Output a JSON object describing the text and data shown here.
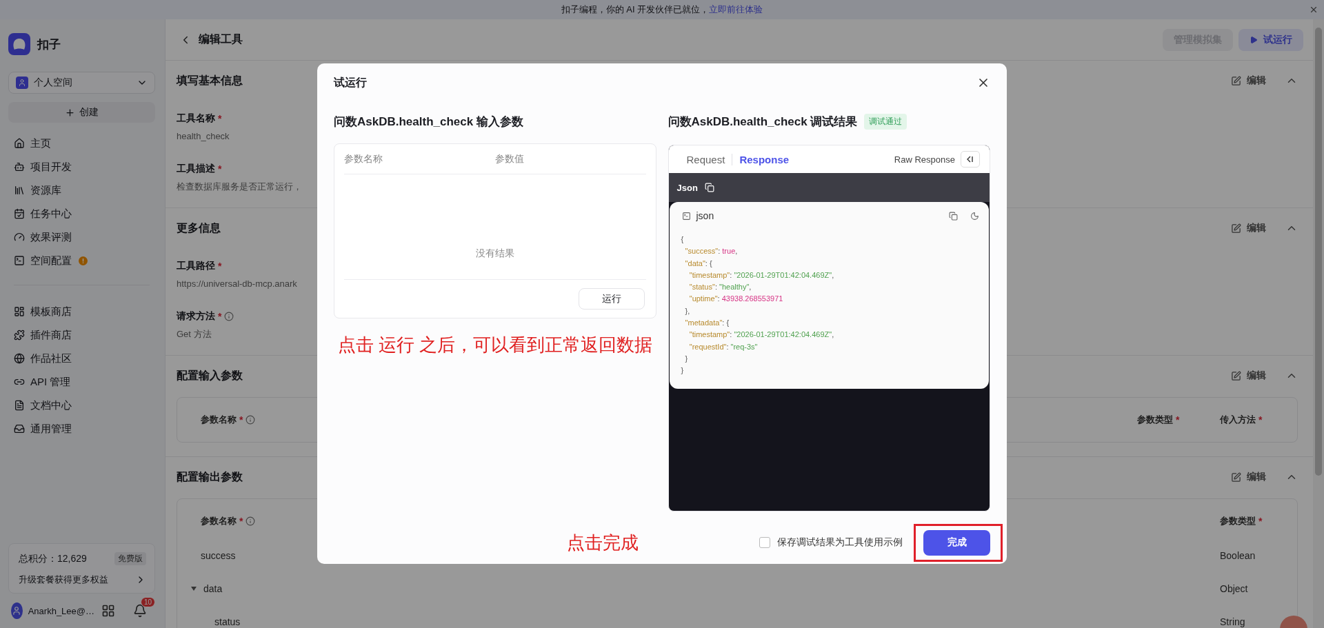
{
  "banner": {
    "text": "扣子编程，你的 AI 开发伙伴已就位，",
    "link": "立即前往体验"
  },
  "sidebar": {
    "brand": "扣子",
    "workspace": "个人空间",
    "create": "创建",
    "nav_groups": [
      [
        {
          "label": "主页",
          "alert": false
        },
        {
          "label": "项目开发",
          "alert": false
        },
        {
          "label": "资源库",
          "alert": false
        },
        {
          "label": "任务中心",
          "alert": false
        },
        {
          "label": "效果评测",
          "alert": false
        },
        {
          "label": "空间配置",
          "alert": true
        }
      ],
      [
        {
          "label": "模板商店",
          "alert": false
        },
        {
          "label": "插件商店",
          "alert": false
        },
        {
          "label": "作品社区",
          "alert": false
        },
        {
          "label": "API 管理",
          "alert": false
        },
        {
          "label": "文档中心",
          "alert": false
        },
        {
          "label": "通用管理",
          "alert": false
        }
      ]
    ],
    "points": {
      "total": "总积分：12,629",
      "plan": "免费版",
      "upgrade": "升级套餐获得更多权益"
    },
    "user": {
      "name": "Anarkh_Lee@…",
      "notifications": "10"
    }
  },
  "header": {
    "title": "编辑工具",
    "buttons": [
      {
        "label": "管理模拟集",
        "kind": "secondary",
        "disabled": true
      },
      {
        "label": "试运行",
        "kind": "primary",
        "disabled": false
      }
    ]
  },
  "sections": [
    {
      "title": "填写基本信息",
      "action": "编辑",
      "expanded": true,
      "fields": [
        {
          "label": "工具名称",
          "required_mark": "*",
          "info": false,
          "value": "health_check"
        },
        {
          "label": "工具描述",
          "required_mark": "*",
          "info": false,
          "value": "检查数据库服务是否正常运行，"
        }
      ]
    },
    {
      "title": "更多信息",
      "action": "编辑",
      "expanded": true,
      "fields": [
        {
          "label": "工具路径",
          "required_mark": "*",
          "info": false,
          "value": "https://universal-db-mcp.anark"
        },
        {
          "label": "请求方法",
          "required_mark": "*",
          "info": true,
          "value": "Get 方法"
        }
      ]
    },
    {
      "title": "配置输入参数",
      "action": "编辑",
      "expanded": true,
      "table": {
        "columns": [
          {
            "label": "参数名称",
            "required_mark": "*",
            "info": true
          },
          {
            "label": "参数类型",
            "required_mark": "*",
            "info": false
          },
          {
            "label": "传入方法",
            "required_mark": "*",
            "info": false
          }
        ]
      }
    },
    {
      "title": "配置输出参数",
      "action": "编辑",
      "expanded": true,
      "table": {
        "columns": [
          {
            "label": "参数名称",
            "required_mark": "*",
            "info": true
          },
          {
            "label": "参数类型",
            "required_mark": "*",
            "info": false
          }
        ],
        "rows": [
          {
            "cells": [
              "success",
              "Boolean"
            ]
          },
          {
            "cells": [
              "data",
              "Object"
            ],
            "expanded": true,
            "children": [
              {
                "cells": [
                  "status",
                  "String"
                ]
              }
            ]
          }
        ]
      }
    }
  ],
  "dialog": {
    "title": "试运行",
    "input": {
      "heading": "问数AskDB.health_check 输入参数",
      "columns": [
        "参数名称",
        "参数值"
      ],
      "empty": "没有结果",
      "run": "运行"
    },
    "annotations": [
      {
        "text": "点击 运行 之后，可以看到正常返回数据"
      },
      {
        "text": "点击完成"
      }
    ],
    "result": {
      "heading": "问数AskDB.health_check 调试结果",
      "status": "调试通过",
      "tabs": [
        {
          "label": "Request",
          "selected": false
        },
        {
          "label": "Response",
          "selected": true
        }
      ],
      "raw": "Raw Response",
      "format": "Json",
      "code_title": "json",
      "code": [
        [
          {
            "text": "{",
            "kind": "punct"
          }
        ],
        [
          {
            "text": "  \"success\"",
            "kind": "key"
          },
          {
            "text": ": ",
            "kind": "punct"
          },
          {
            "text": "true",
            "kind": "literal"
          },
          {
            "text": ",",
            "kind": "punct"
          }
        ],
        [
          {
            "text": "  \"data\"",
            "kind": "key"
          },
          {
            "text": ": {",
            "kind": "punct"
          }
        ],
        [
          {
            "text": "    \"timestamp\"",
            "kind": "key"
          },
          {
            "text": ": ",
            "kind": "punct"
          },
          {
            "text": "\"2026-01-29T01:42:04.469Z\"",
            "kind": "string"
          },
          {
            "text": ",",
            "kind": "punct"
          }
        ],
        [
          {
            "text": "    \"status\"",
            "kind": "key"
          },
          {
            "text": ": ",
            "kind": "punct"
          },
          {
            "text": "\"healthy\"",
            "kind": "string"
          },
          {
            "text": ",",
            "kind": "punct"
          }
        ],
        [
          {
            "text": "    \"uptime\"",
            "kind": "key"
          },
          {
            "text": ": ",
            "kind": "punct"
          },
          {
            "text": "43938.268553971",
            "kind": "number"
          }
        ],
        [
          {
            "text": "  },",
            "kind": "punct"
          }
        ],
        [
          {
            "text": "  \"metadata\"",
            "kind": "key"
          },
          {
            "text": ": {",
            "kind": "punct"
          }
        ],
        [
          {
            "text": "    \"timestamp\"",
            "kind": "key"
          },
          {
            "text": ": ",
            "kind": "punct"
          },
          {
            "text": "\"2026-01-29T01:42:04.469Z\"",
            "kind": "string"
          },
          {
            "text": ",",
            "kind": "punct"
          }
        ],
        [
          {
            "text": "    \"requestId\"",
            "kind": "key"
          },
          {
            "text": ": ",
            "kind": "punct"
          },
          {
            "text": "\"req-3s\"",
            "kind": "string"
          }
        ],
        [
          {
            "text": "  }",
            "kind": "punct"
          }
        ],
        [
          {
            "text": "}",
            "kind": "punct"
          }
        ]
      ]
    },
    "save_example": {
      "label": "保存调试结果为工具使用示例",
      "checked": false
    },
    "done": {
      "label": "完成",
      "highlighted": true
    }
  }
}
